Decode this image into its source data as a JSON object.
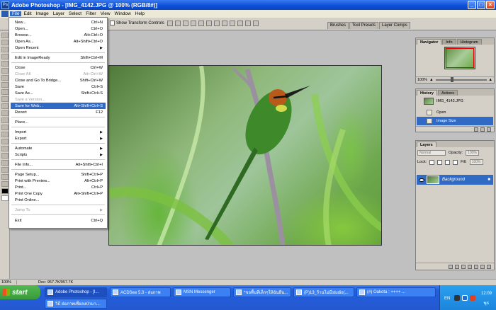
{
  "window": {
    "title": "Adobe Photoshop - [IMG_4142.JPG @ 100% (RGB/8#)]",
    "controls": [
      "_",
      "□",
      "×"
    ]
  },
  "menubar": [
    "File",
    "Edit",
    "Image",
    "Layer",
    "Select",
    "Filter",
    "View",
    "Window",
    "Help"
  ],
  "options_bar": {
    "show_transform_controls": "Show Transform Controls",
    "wells": [
      "Brushes",
      "Tool Presets",
      "Layer Comps"
    ]
  },
  "file_menu": [
    {
      "label": "New...",
      "shortcut": "Ctrl+N"
    },
    {
      "label": "Open...",
      "shortcut": "Ctrl+O"
    },
    {
      "label": "Browse...",
      "shortcut": "Alt+Ctrl+O"
    },
    {
      "label": "Open As...",
      "shortcut": "Alt+Shift+Ctrl+O"
    },
    {
      "label": "Open Recent",
      "shortcut": "",
      "submenu": true
    },
    {
      "label": "Edit in ImageReady",
      "shortcut": "Shift+Ctrl+M"
    },
    {
      "label": "Close",
      "shortcut": "Ctrl+W"
    },
    {
      "label": "Close All",
      "shortcut": "Alt+Ctrl+W",
      "disabled": true
    },
    {
      "label": "Close and Go To Bridge...",
      "shortcut": "Shift+Ctrl+W"
    },
    {
      "label": "Save",
      "shortcut": "Ctrl+S"
    },
    {
      "label": "Save As...",
      "shortcut": "Shift+Ctrl+S"
    },
    {
      "label": "Save a Version...",
      "shortcut": "",
      "disabled": true
    },
    {
      "label": "Save for Web...",
      "shortcut": "Alt+Shift+Ctrl+S",
      "highlighted": true
    },
    {
      "label": "Revert",
      "shortcut": "F12"
    },
    {
      "label": "Place...",
      "shortcut": ""
    },
    {
      "label": "Import",
      "shortcut": "",
      "submenu": true
    },
    {
      "label": "Export",
      "shortcut": "",
      "submenu": true
    },
    {
      "label": "Automate",
      "shortcut": "",
      "submenu": true
    },
    {
      "label": "Scripts",
      "shortcut": "",
      "submenu": true
    },
    {
      "label": "File Info...",
      "shortcut": "Alt+Shift+Ctrl+I"
    },
    {
      "label": "Page Setup...",
      "shortcut": "Shift+Ctrl+P"
    },
    {
      "label": "Print with Preview...",
      "shortcut": "Alt+Ctrl+P"
    },
    {
      "label": "Print...",
      "shortcut": "Ctrl+P"
    },
    {
      "label": "Print One Copy",
      "shortcut": "Alt+Shift+Ctrl+P"
    },
    {
      "label": "Print Online...",
      "shortcut": ""
    },
    {
      "label": "Jump To",
      "shortcut": "",
      "submenu": true,
      "disabled": true
    },
    {
      "label": "Exit",
      "shortcut": "Ctrl+Q"
    }
  ],
  "navigator": {
    "tabs": [
      "Navigator",
      "Info",
      "Histogram"
    ],
    "zoom": "100%"
  },
  "history": {
    "tabs": [
      "History",
      "Actions"
    ],
    "snapshot": "IMG_4142.JPG",
    "states": [
      "Open",
      "Image Size"
    ]
  },
  "layers": {
    "tabs": [
      "Layers"
    ],
    "blend_mode": "Normal",
    "opacity_label": "Opacity:",
    "opacity": "100%",
    "lock_label": "Lock:",
    "fill_label": "Fill:",
    "fill": "100%",
    "layer_name": "Background"
  },
  "statusbar": {
    "zoom": "100%",
    "doc": "Doc: 957.7K/957.7K"
  },
  "taskbar": {
    "start": "start",
    "buttons_row1": [
      "Adobe Photoshop - [I...",
      "ACDSee 5.0 - ส่งภาพ",
      "MSN Messenger",
      "*ขอพื้นที่เล็กๆให้ฉันยืน...",
      "(P)13_ร้านไม่มีstudio(...",
      "(#) Oakota : ++++ ..."
    ],
    "buttons_row2": [
      "วิธี ย่อภาพเพื่อลงป่ามา..."
    ],
    "lang": "EN",
    "time": "12:09",
    "day": "พุธ"
  }
}
